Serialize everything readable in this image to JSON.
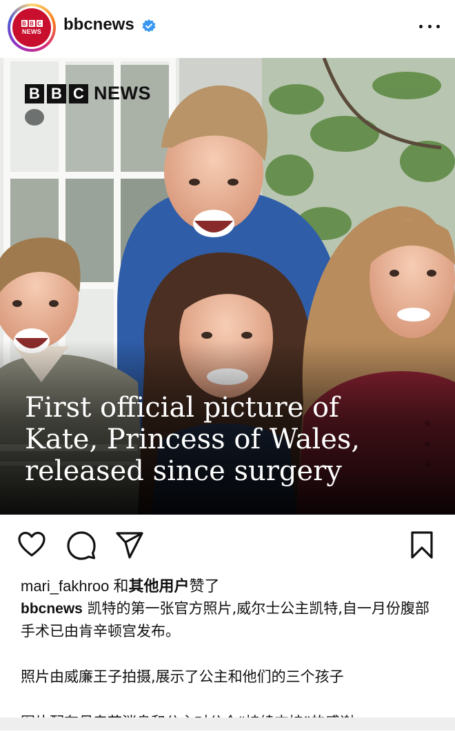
{
  "post": {
    "account": {
      "username": "bbcnews",
      "avatar_top": "BBC",
      "avatar_bottom": "NEWS",
      "verified_icon": "verified-badge-icon"
    },
    "more_icon": "more-horizontal-icon",
    "image": {
      "logo_letters": [
        "B",
        "B",
        "C"
      ],
      "logo_word": "NEWS",
      "headline": "First official picture of\nKate, Princess of Wales,\nreleased since surgery"
    },
    "actions": {
      "like_icon": "heart-icon",
      "comment_icon": "comment-icon",
      "share_icon": "send-icon",
      "save_icon": "bookmark-icon"
    },
    "likes": {
      "first_user": "mari_fakhroo",
      "connector": " 和",
      "others": "其他用户",
      "suffix": "赞了"
    },
    "caption": {
      "username": "bbcnews",
      "text": " 凯特的第一张官方照片,威尔士公主凯特,自一月份腹部手术已由肯辛顿宫发布。",
      "paragraph2": "照片由威廉王子拍摄,展示了公主和他们的三个孩子",
      "paragraph3": "图片配有母亲节消息和公主对公众“持续支持”的感谢。"
    }
  },
  "colors": {
    "bbc_red": "#c8102e",
    "verified_blue": "#3897f0",
    "text": "#111111"
  }
}
